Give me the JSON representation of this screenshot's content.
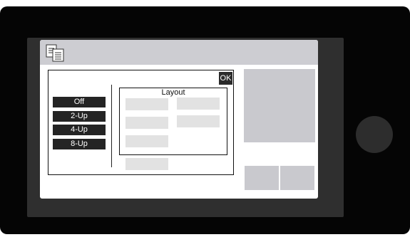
{
  "dialog": {
    "ok_label": "OK",
    "options": [
      "Off",
      "2-Up",
      "4-Up",
      "8-Up"
    ],
    "layout_title": "Layout"
  },
  "icons": {
    "app": "copy-documents-icon"
  },
  "colors": {
    "titlebar": "#cdcdd2",
    "button": "#242424",
    "panel": "#c9c9ce",
    "placeholder": "#e2e2e2"
  }
}
